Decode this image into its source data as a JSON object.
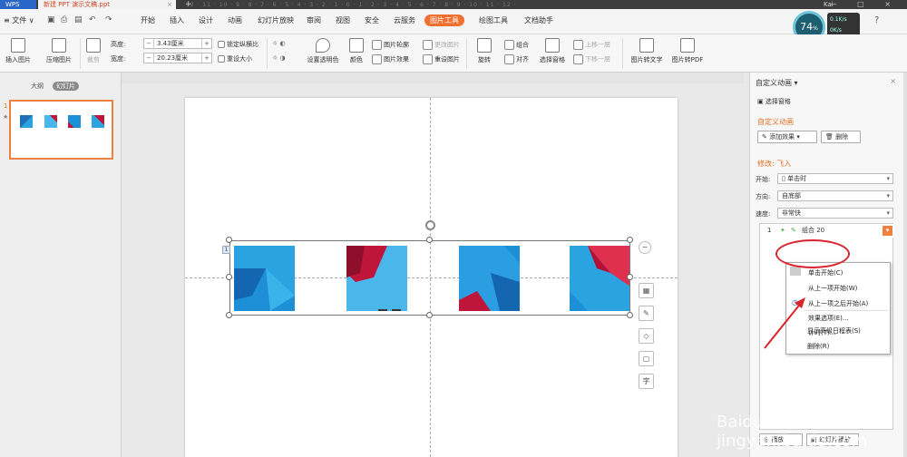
{
  "titlebar": {
    "app": "WPS",
    "doc_title": "新建 PPT 演示文稿.ppt",
    "close": "×",
    "new_tab": "+",
    "user": "Kai",
    "win_controls": "— □ ×"
  },
  "menubar": {
    "file": "≡ 文件 ∨",
    "tabs": [
      "开始",
      "插入",
      "设计",
      "动画",
      "幻灯片放映",
      "审阅",
      "视图",
      "安全",
      "云服务",
      "图片工具",
      "绘图工具",
      "文档助手"
    ],
    "active_tab": "图片工具",
    "help": "?"
  },
  "perf": {
    "cpu": "74",
    "cpu_unit": "%",
    "up": "0.1K/s",
    "down": "0K/s"
  },
  "ribbon": {
    "insert_image": "插入图片",
    "compress": "压缩图片",
    "crop": "裁剪",
    "height_label": "高度:",
    "height_value": "3.43厘米",
    "width_label": "宽度:",
    "width_value": "20.23厘米",
    "lock_ratio": "锁定纵横比",
    "reset_size": "重设大小",
    "set_transparent": "设置透明色",
    "color": "颜色",
    "outline": "图片轮廓",
    "effect": "图片效果",
    "change_image": "更改图片",
    "reset_image": "重设图片",
    "rotate": "旋转",
    "group": "组合",
    "align": "对齐",
    "bring_forward": "上移一层",
    "send_backward": "下移一层",
    "selection_pane": "选择窗格",
    "to_text": "图片转文字",
    "to_pdf": "图片转PDF"
  },
  "left_panel": {
    "outline_tab": "大纲",
    "slides_tab": "幻灯片",
    "slide_number": "1",
    "star": "★"
  },
  "ruler": {
    "text": "12 · 11 · 10 · 9 · 8 · 7 · 6 · 5 · 4 · 3 · 2 · 1 · 0 · 1 · 2 · 3 · 4 · 5 · 6 · 7 · 8 · 9 · 10 · 11 · 12 ·"
  },
  "canvas": {
    "anim_index": "1"
  },
  "right_panel": {
    "title": "自定义动画 ▾",
    "close": "×",
    "selection_pane": "选择窗格",
    "section_custom": "自定义动画",
    "add_effect": "添加效果 ▾",
    "delete": "删除",
    "modify": "修改: 飞入",
    "start_label": "开始:",
    "start_value": "单击时",
    "direction_label": "方向:",
    "direction_value": "自底部",
    "speed_label": "速度:",
    "speed_value": "非常快",
    "list_item_index": "1",
    "list_item_label": "组合 20",
    "play": "播放",
    "slideshow": "幻灯片播放"
  },
  "context_menu": {
    "items": [
      "单击开始(C)",
      "从上一项开始(W)",
      "从上一项之后开始(A)",
      "效果选项(E)...",
      "计时(T)...",
      "显示高级日程表(S)",
      "删除(R)"
    ]
  },
  "watermark": "Baidu jingyan.baidu.com"
}
